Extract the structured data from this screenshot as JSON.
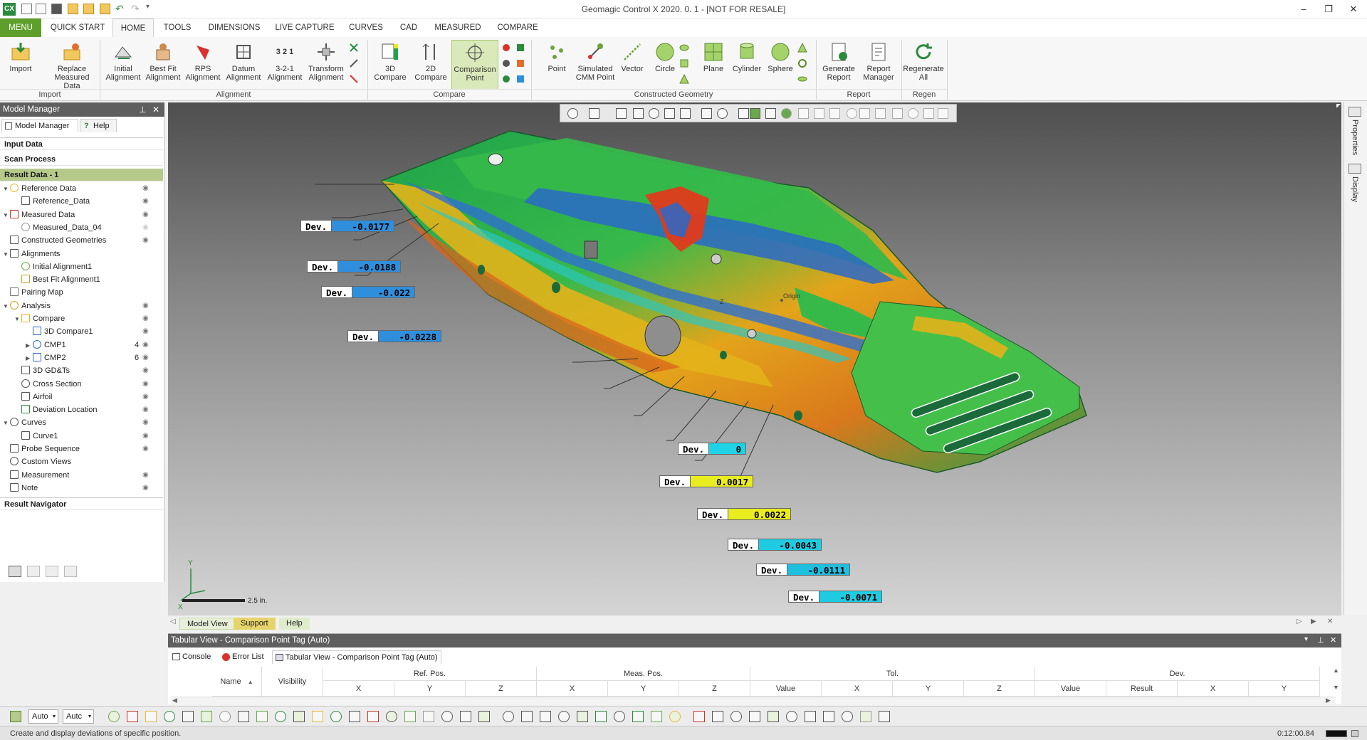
{
  "app": {
    "title": "Geomagic Control X 2020. 0. 1 - [NOT FOR RESALE]",
    "logo_text": "CX"
  },
  "window_controls": {
    "minimize": "–",
    "restore": "❐",
    "close": "✕"
  },
  "tabs": [
    "MENU",
    "QUICK START",
    "HOME",
    "TOOLS",
    "DIMENSIONS",
    "LIVE CAPTURE",
    "CURVES",
    "CAD",
    "MEASURED",
    "COMPARE"
  ],
  "ribbon": {
    "import": {
      "label": "Import",
      "buttons": [
        [
          "Import"
        ],
        [
          "Replace",
          "Measured Data"
        ]
      ]
    },
    "alignment": {
      "label": "Alignment",
      "buttons": [
        [
          "Initial",
          "Alignment"
        ],
        [
          "Best Fit",
          "Alignment"
        ],
        [
          "RPS",
          "Alignment"
        ],
        [
          "Datum",
          "Alignment"
        ],
        [
          "3-2-1",
          "Alignment"
        ],
        [
          "Transform",
          "Alignment"
        ]
      ]
    },
    "compare": {
      "label": "Compare",
      "buttons": [
        [
          "3D",
          "Compare"
        ],
        [
          "2D",
          "Compare"
        ],
        [
          "Comparison",
          "Point"
        ]
      ]
    },
    "constructed": {
      "label": "Constructed Geometry",
      "buttons": [
        [
          "Point"
        ],
        [
          "Simulated",
          "CMM Point"
        ],
        [
          "Vector"
        ],
        [
          "Circle"
        ],
        [
          "Plane"
        ],
        [
          "Cylinder"
        ],
        [
          "Sphere"
        ]
      ]
    },
    "report": {
      "label": "Report",
      "buttons": [
        [
          "Generate",
          "Report"
        ],
        [
          "Report",
          "Manager"
        ]
      ]
    },
    "regen": {
      "label": "Regen",
      "buttons": [
        [
          "Regenerate",
          "All"
        ]
      ]
    },
    "icon_321_text": "3 2 1"
  },
  "left_panel": {
    "header": "Model Manager",
    "pin": "⊥",
    "close": "✕",
    "subtabs": [
      "Model Manager",
      "Help"
    ],
    "sections": {
      "input": "Input Data",
      "scan": "Scan Process",
      "result": "Result Data - 1",
      "navigator": "Result Navigator"
    },
    "tree": [
      {
        "label": "Reference Data",
        "level": 0,
        "twisty": "▼",
        "eye": true
      },
      {
        "label": "Reference_Data",
        "level": 1,
        "twisty": "",
        "eye": true
      },
      {
        "label": "Measured Data",
        "level": 0,
        "twisty": "▼",
        "eye": true
      },
      {
        "label": "Measured_Data_04",
        "level": 1,
        "twisty": "",
        "eye": "dim"
      },
      {
        "label": "Constructed Geometries",
        "level": 0,
        "twisty": "",
        "eye": true
      },
      {
        "label": "Alignments",
        "level": 0,
        "twisty": "▼",
        "eye": false
      },
      {
        "label": "Initial Alignment1",
        "level": 1,
        "twisty": "",
        "eye": false
      },
      {
        "label": "Best Fit Alignment1",
        "level": 1,
        "twisty": "",
        "eye": false
      },
      {
        "label": "Pairing Map",
        "level": 0,
        "twisty": "",
        "eye": false
      },
      {
        "label": "Analysis",
        "level": 0,
        "twisty": "▼",
        "eye": true
      },
      {
        "label": "Compare",
        "level": 1,
        "twisty": "▼",
        "eye": true
      },
      {
        "label": "3D Compare1",
        "level": 2,
        "twisty": "",
        "eye": true
      },
      {
        "label": "CMP1",
        "level": 2,
        "twisty": "▶",
        "eye": true,
        "count": "4"
      },
      {
        "label": "CMP2",
        "level": 2,
        "twisty": "▶",
        "eye": true,
        "count": "6"
      },
      {
        "label": "3D GD&Ts",
        "level": 1,
        "twisty": "",
        "eye": true
      },
      {
        "label": "Cross Section",
        "level": 1,
        "twisty": "",
        "eye": true
      },
      {
        "label": "Airfoil",
        "level": 1,
        "twisty": "",
        "eye": true
      },
      {
        "label": "Deviation Location",
        "level": 1,
        "twisty": "",
        "eye": true
      },
      {
        "label": "Curves",
        "level": 0,
        "twisty": "▼",
        "eye": true
      },
      {
        "label": "Curve1",
        "level": 1,
        "twisty": "",
        "eye": true
      },
      {
        "label": "Probe Sequence",
        "level": 0,
        "twisty": "",
        "eye": true
      },
      {
        "label": "Custom Views",
        "level": 0,
        "twisty": "",
        "eye": false
      },
      {
        "label": "Measurement",
        "level": 0,
        "twisty": "",
        "eye": true
      },
      {
        "label": "Note",
        "level": 0,
        "twisty": "",
        "eye": true
      }
    ]
  },
  "viewport": {
    "dev_label": "Dev.",
    "tags": [
      {
        "value": "-0.0177",
        "color": "#2f8fdc"
      },
      {
        "value": "-0.0188",
        "color": "#2f8fdc"
      },
      {
        "value": "-0.022",
        "color": "#2f8fdc"
      },
      {
        "value": "-0.0228",
        "color": "#2f8fdc"
      },
      {
        "value": "0",
        "color": "#1fd2e6"
      },
      {
        "value": "0.0017",
        "color": "#e9ec1f"
      },
      {
        "value": "0.0022",
        "color": "#e9ec1f"
      },
      {
        "value": "-0.0043",
        "color": "#1fcbe0"
      },
      {
        "value": "-0.0111",
        "color": "#1fbfe0"
      },
      {
        "value": "-0.0071",
        "color": "#1fcbe0"
      }
    ],
    "scale_label": "2.5 in.",
    "origin_label": "Origin",
    "axis_z": "Z",
    "axis_y": "Y",
    "axis_x": "X"
  },
  "view_tabs": [
    "Model View",
    "Support",
    "Help"
  ],
  "tabular": {
    "header": "Tabular View - Comparison Point Tag (Auto)",
    "tabs": [
      "Console",
      "Error List",
      "Tabular View - Comparison Point Tag (Auto)"
    ],
    "col_groups": [
      "Ref. Pos.",
      "Meas. Pos.",
      "Tol.",
      "Dev."
    ],
    "name_col": "Name",
    "visibility_col": "Visibility",
    "sub_cols": [
      "X",
      "Y",
      "Z",
      "X",
      "Y",
      "Z",
      "Value",
      "X",
      "Y",
      "Z",
      "Value",
      "Result",
      "X",
      "Y"
    ]
  },
  "bottom_toolbar": {
    "combo1": "Auto",
    "combo2": "Autc"
  },
  "status": {
    "text": "Create and display deviations of specific position.",
    "time": "0:12:00.84"
  },
  "right_dock": [
    "Properties",
    "Display"
  ],
  "colors": {
    "accent": "#5e9e2a",
    "selected_section": "#b5c98b",
    "header_dark": "#5f5f5f"
  }
}
